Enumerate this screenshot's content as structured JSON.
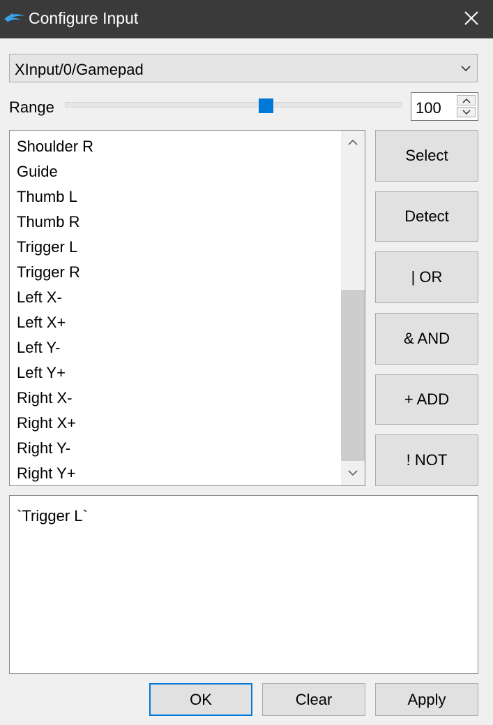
{
  "window": {
    "title": "Configure Input",
    "app_icon": "dolphin-icon",
    "close_icon": "close-icon"
  },
  "device": {
    "selected": "XInput/0/Gamepad",
    "icon": "chevron-down-icon"
  },
  "range": {
    "label": "Range",
    "value": "100",
    "slider_fraction": 0.6
  },
  "inputs": {
    "items": [
      "Shoulder R",
      "Guide",
      "Thumb L",
      "Thumb R",
      "Trigger L",
      "Trigger R",
      "Left X-",
      "Left X+",
      "Left Y-",
      "Left Y+",
      "Right X-",
      "Right X+",
      "Right Y-",
      "Right Y+"
    ]
  },
  "actions": {
    "select": "Select",
    "detect": "Detect",
    "or": "| OR",
    "and": "& AND",
    "add": "+ ADD",
    "not": "! NOT"
  },
  "expression": {
    "text": "`Trigger L`"
  },
  "footer": {
    "ok": "OK",
    "clear": "Clear",
    "apply": "Apply"
  },
  "colors": {
    "titlebar": "#3a3a3a",
    "accent": "#0078d7",
    "dialog_bg": "#f0f0f0"
  }
}
